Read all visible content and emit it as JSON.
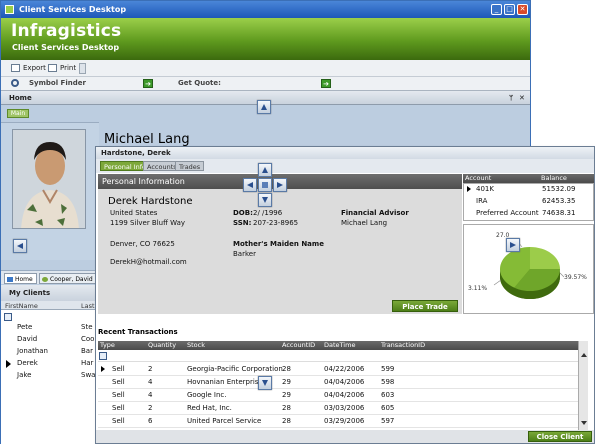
{
  "main_window": {
    "title": "Client Services Desktop",
    "banner_title": "Infragistics",
    "banner_subtitle": "Client Services Desktop",
    "toolbar": {
      "export_label": "Export",
      "print_label": "Print"
    },
    "symbol_finder_label": "Symbol Finder",
    "get_quote_label": "Get Quote:",
    "home_header": "Home",
    "main_tab": "Main",
    "client_name": "Michael Lang",
    "nav_tabs": [
      "Home",
      "Cooper, David"
    ],
    "my_clients": {
      "title": "My Clients",
      "headers": [
        "FirstName",
        "Last"
      ],
      "rows": [
        {
          "first": "Pete",
          "last": "Ste"
        },
        {
          "first": "David",
          "last": "Coo"
        },
        {
          "first": "Jonathan",
          "last": "Bar"
        },
        {
          "first": "Derek",
          "last": "Har"
        },
        {
          "first": "Jake",
          "last": "Swa"
        }
      ]
    }
  },
  "client_window": {
    "title": "Hardstone, Derek",
    "tabs": [
      "Personal Info",
      "Accounts",
      "Trades"
    ],
    "personal_info": {
      "header": "Personal Information",
      "name": "Derek Hardstone",
      "country": "United States",
      "street": "1199 Silver Bluff Way",
      "city": "Denver, CO 76625",
      "email": "DerekH@hotmail.com",
      "dob_label": "DOB:",
      "dob_value": "2/  /1996",
      "ssn_label": "SSN:",
      "ssn_value": "207-23-8965",
      "mmn_label": "Mother's Maiden Name",
      "mmn_value": "Barker",
      "advisor_label": "Financial Advisor",
      "advisor_value": "Michael Lang",
      "place_trade": "Place Trade"
    },
    "accounts": {
      "headers": [
        "Account",
        "Balance"
      ],
      "rows": [
        {
          "account": "401K",
          "balance": "51532.09"
        },
        {
          "account": "IRA",
          "balance": "62453.35"
        },
        {
          "account": "Preferred Account",
          "balance": "74638.31"
        }
      ]
    },
    "pie_labels": [
      "27.0",
      "39.57%",
      "3.11%"
    ],
    "recent_transactions": {
      "title": "Recent Transactions",
      "headers": [
        "Type",
        "Quantity",
        "Stock",
        "AccountID",
        "DateTime",
        "TransactionID"
      ],
      "rows": [
        {
          "type": "Sell",
          "qty": "2",
          "stock": "Georgia-Pacific Corporation",
          "acct": "28",
          "date": "04/22/2006",
          "tid": "599"
        },
        {
          "type": "Sell",
          "qty": "4",
          "stock": "Hovnanian Enterprise",
          "acct": "29",
          "date": "04/04/2006",
          "tid": "598"
        },
        {
          "type": "Sell",
          "qty": "4",
          "stock": "Google Inc.",
          "acct": "29",
          "date": "04/04/2006",
          "tid": "603"
        },
        {
          "type": "Sell",
          "qty": "2",
          "stock": "Red Hat, Inc.",
          "acct": "28",
          "date": "03/03/2006",
          "tid": "605"
        },
        {
          "type": "Sell",
          "qty": "6",
          "stock": "United Parcel Service",
          "acct": "28",
          "date": "03/29/2006",
          "tid": "597"
        }
      ]
    },
    "close_client": "Close Client"
  },
  "colors": {
    "brand_green": "#5f9a1e",
    "title_blue": "#2a63c2",
    "header_gray": "#555555"
  }
}
